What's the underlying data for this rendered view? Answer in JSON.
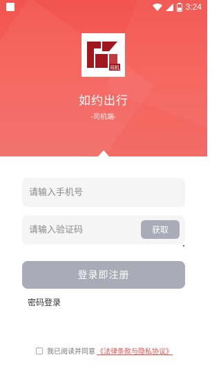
{
  "status_bar": {
    "time": "3:24"
  },
  "brand": {
    "app_name": "如约出行",
    "subtitle": "-司机端-",
    "logo_text": "司机"
  },
  "login": {
    "phone_placeholder": "请输入手机号",
    "code_placeholder": "请输入验证码",
    "get_code_label": "获取",
    "submit_label": "登录即注册",
    "password_login_label": "密码登录"
  },
  "agreement": {
    "prefix": "我已阅读并同意",
    "link_label": "《法律条款与隐私协议》"
  },
  "colors": {
    "header_red": "#f2544f",
    "button_gray": "#a9acb6",
    "link_red": "#e8504b",
    "logo_red": "#a0181d"
  },
  "icons": [
    "status-square-icon",
    "wifi-icon",
    "signal-icon",
    "battery-icon",
    "app-logo-icon",
    "checkbox-icon"
  ]
}
